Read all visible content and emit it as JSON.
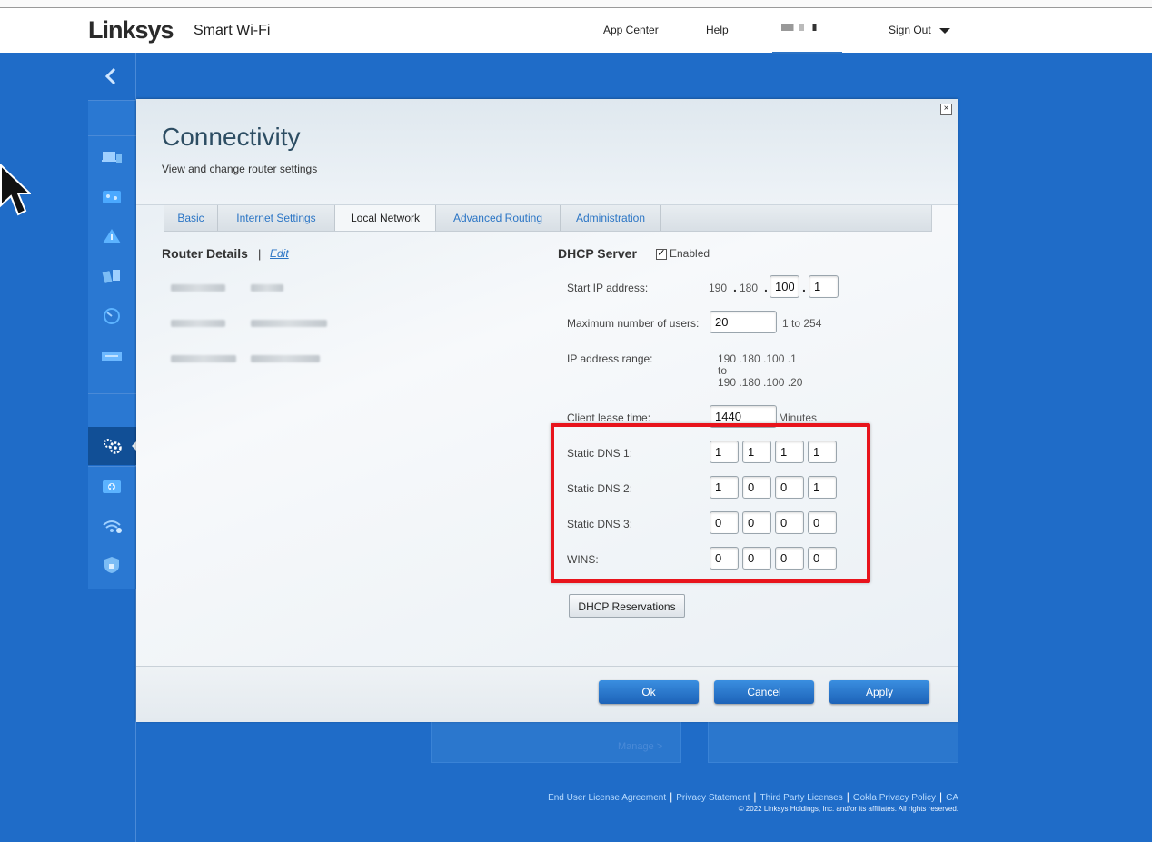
{
  "header": {
    "brand": "Linksys",
    "product": "Smart Wi-Fi",
    "nav": [
      "App Center",
      "Help"
    ],
    "sign_out": "Sign Out"
  },
  "sidebar": {
    "icons": [
      "devices-icon",
      "network-map-icon",
      "alert-icon",
      "parental-controls-icon",
      "speed-test-icon",
      "usb-storage-icon",
      "connectivity-settings-icon",
      "troubleshooting-icon",
      "wireless-icon",
      "security-icon"
    ],
    "active": "connectivity-settings-icon"
  },
  "dialog": {
    "title": "Connectivity",
    "subtitle": "View and change router settings",
    "close": "×",
    "tabs": [
      "Basic",
      "Internet Settings",
      "Local Network",
      "Advanced Routing",
      "Administration"
    ],
    "active_tab": "Local Network",
    "router_details": {
      "title": "Router Details",
      "separator": "|",
      "edit": "Edit"
    },
    "dhcp": {
      "title": "DHCP Server",
      "enabled_label": "Enabled",
      "enabled": true,
      "start_ip_label": "Start IP address:",
      "start_ip_fixed": [
        "190",
        "180"
      ],
      "start_ip_inputs": [
        "100",
        "1"
      ],
      "max_users_label": "Maximum number of users:",
      "max_users": "20",
      "max_users_range": "1 to 254",
      "range_label": "IP address range:",
      "range_start": "190 .180 .100 .1",
      "range_to": "to",
      "range_end": "190 .180 .100 .20",
      "lease_label": "Client lease time:",
      "lease": "1440",
      "lease_unit": "Minutes",
      "dns1_label": "Static DNS 1:",
      "dns1": [
        "1",
        "1",
        "1",
        "1"
      ],
      "dns2_label": "Static DNS 2:",
      "dns2": [
        "1",
        "0",
        "0",
        "1"
      ],
      "dns3_label": "Static DNS 3:",
      "dns3": [
        "0",
        "0",
        "0",
        "0"
      ],
      "wins_label": "WINS:",
      "wins": [
        "0",
        "0",
        "0",
        "0"
      ],
      "reservations_button": "DHCP Reservations"
    },
    "buttons": {
      "ok": "Ok",
      "cancel": "Cancel",
      "apply": "Apply"
    }
  },
  "background": {
    "manage_link": "Manage >"
  },
  "footer": {
    "links": [
      "End User License Agreement",
      "Privacy Statement",
      "Third Party Licenses",
      "Ookla Privacy Policy",
      "CA"
    ],
    "copyright": "© 2022 Linksys Holdings, Inc. and/or its affiliates. All rights reserved."
  },
  "colors": {
    "background": "#1f6cc8",
    "link": "#2b75c5",
    "highlight": "#e8141c",
    "primary_button": "#2b7bd3"
  }
}
